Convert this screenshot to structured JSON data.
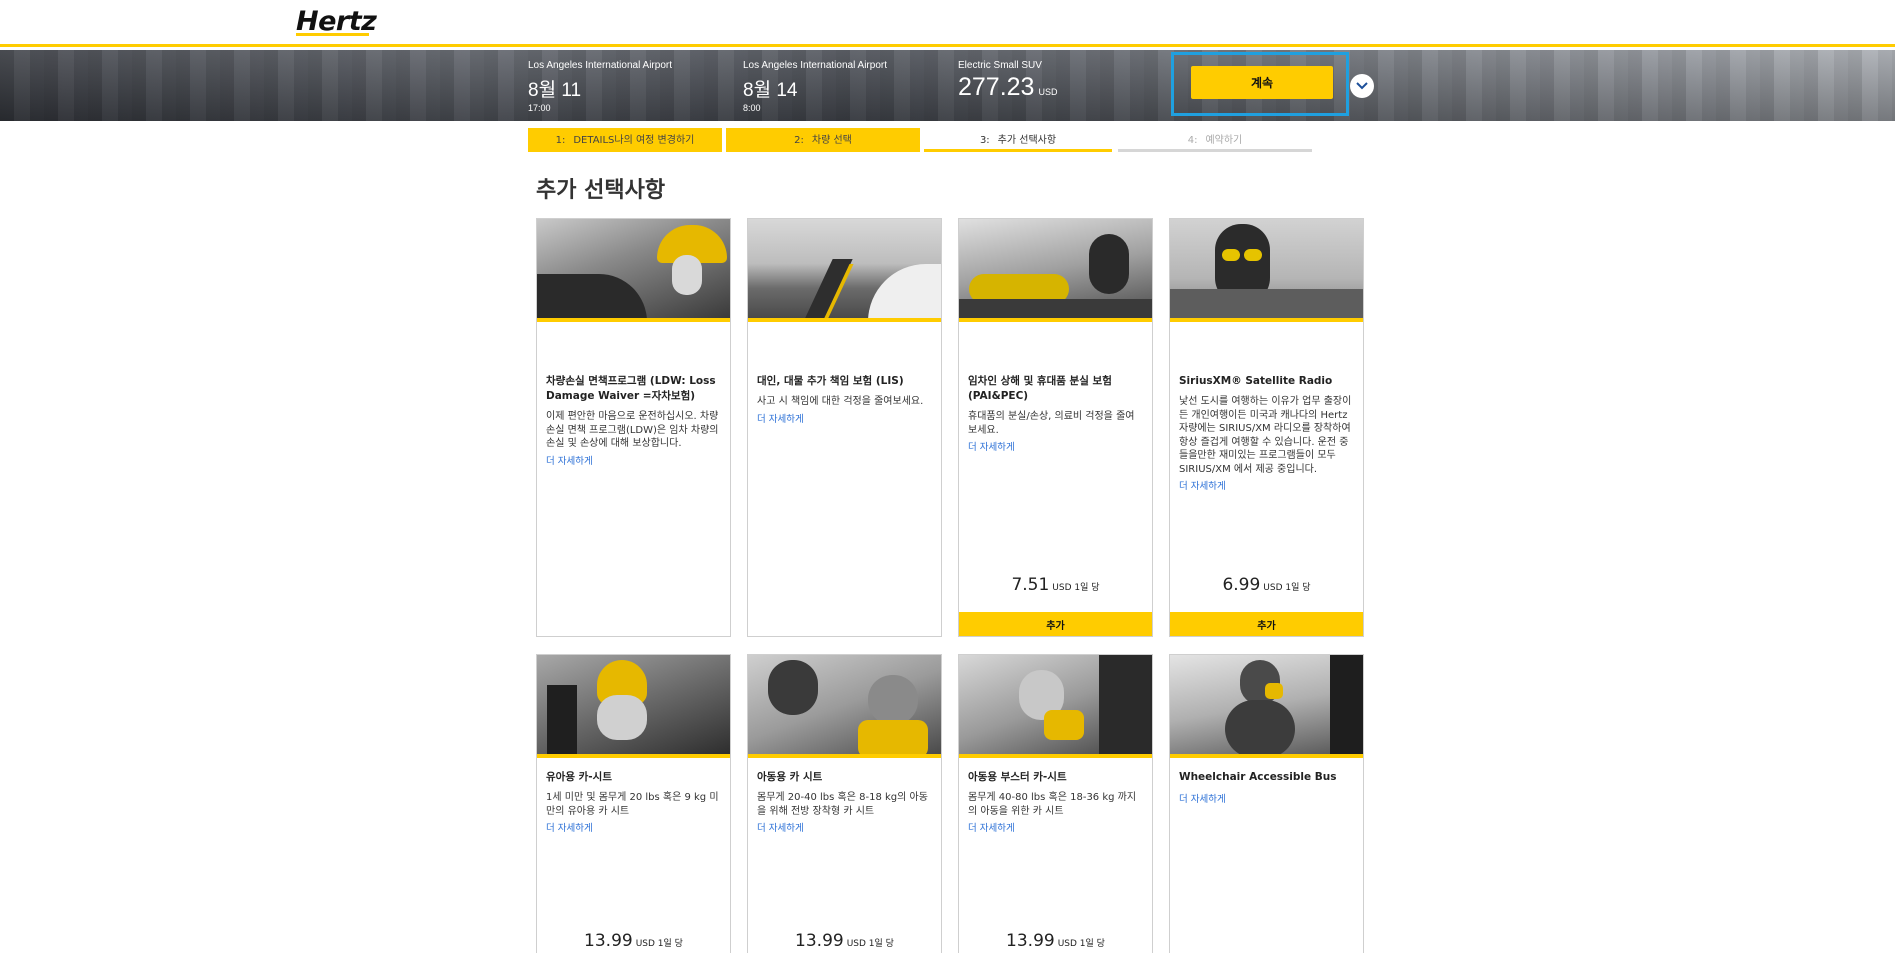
{
  "brand": {
    "logo_text": "Hertz"
  },
  "trip": {
    "pickup": {
      "location": "Los Angeles International Airport",
      "date": "8월 11",
      "time": "17:00"
    },
    "dropoff": {
      "location": "Los Angeles International Airport",
      "date": "8월 14",
      "time": "8:00"
    },
    "vehicle": {
      "name": "Electric Small SUV",
      "price": "277.23",
      "currency": "USD"
    },
    "continue_label": "계속"
  },
  "steps": [
    {
      "num": "1:",
      "label": "DETAILS나의 여정 변경하기",
      "state": "done"
    },
    {
      "num": "2:",
      "label": "차량 선택",
      "state": "done"
    },
    {
      "num": "3:",
      "label": "추가 선택사항",
      "state": "active"
    },
    {
      "num": "4:",
      "label": "예약하기",
      "state": "future"
    }
  ],
  "page_title": "추가 선택사항",
  "more_label": "더 자세하게",
  "add_label": "추가",
  "cards": [
    {
      "title": "차량손실 면책프로그램 (LDW: Loss Damage Waiver =자차보험)",
      "desc": "이제 편안한 마음으로 운전하십시오. 차량손실 면책 프로그램(LDW)은 임차 차량의 손실 및 손상에 대해 보상합니다."
    },
    {
      "title": "대인, 대물 추가 책임 보험 (LIS)",
      "desc": "사고 시 책임에 대한 걱정을 줄여보세요."
    },
    {
      "title": "임차인 상해 및 휴대품 분실 보험 (PAI&PEC)",
      "desc": "휴대품의 분실/손상, 의료비 걱정을 줄여보세요.",
      "price": "7.51",
      "unit": "USD 1일 당"
    },
    {
      "title": "SiriusXM® Satellite Radio",
      "desc": "낯선 도시를 여행하는 이유가 업무 출장이든 개인여행이든 미국과 캐나다의 Hertz 자량에는 SIRIUS/XM 라디오를 장착하여 항상 즐겁게 여행할 수 있습니다. 운전 중 들을만한 재미있는 프로그램들이 모두 SIRIUS/XM 에서 제공 중입니다.",
      "price": "6.99",
      "unit": "USD 1일 당"
    },
    {
      "title": "유아용 카-시트",
      "desc": "1세 미만 및 몸무게 20 lbs 혹은 9 kg 미만의 유아용 카 시트",
      "price": "13.99",
      "unit": "USD 1일 당"
    },
    {
      "title": "아동용 카 시트",
      "desc": "몸무게 20-40 lbs 혹은 8-18 kg의 아동을 위해 전방 장착형 카 시트",
      "price": "13.99",
      "unit": "USD 1일 당"
    },
    {
      "title": "아동용 부스터 카-시트",
      "desc": "몸무게 40-80 lbs 혹은 18-36 kg 까지의 아동을 위한 카 시트",
      "price": "13.99",
      "unit": "USD 1일 당"
    },
    {
      "title": "Wheelchair Accessible Bus",
      "desc": ""
    }
  ],
  "colors": {
    "accent": "#ffcc00",
    "link": "#2a6fd6",
    "focus": "#1fa0e0"
  }
}
